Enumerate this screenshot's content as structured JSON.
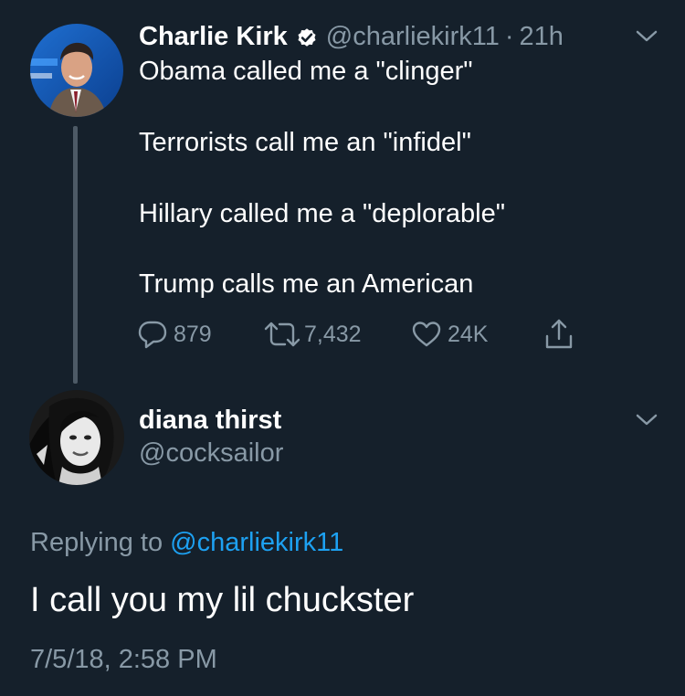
{
  "original_tweet": {
    "author_name": "Charlie Kirk",
    "verified": true,
    "handle": "@charliekirk11",
    "separator": "·",
    "time_ago": "21h",
    "lines": [
      "Obama called me a \"clinger\"",
      "Terrorists call me an \"infidel\"",
      "Hillary called me a \"deplorable\"",
      "Trump calls me an American"
    ],
    "actions": {
      "replies": "879",
      "retweets": "7,432",
      "likes": "24K"
    }
  },
  "reply_tweet": {
    "author_name": "diana thirst",
    "handle": "@cocksailor",
    "replying_prefix": "Replying to",
    "replying_mention": "@charliekirk11",
    "text": "I call you my lil chuckster",
    "timestamp": "7/5/18, 2:58 PM"
  },
  "colors": {
    "background": "#15202b",
    "text_primary": "#ffffff",
    "text_secondary": "#8899a6",
    "link": "#1da1f2",
    "thread_line": "#4d5a66"
  },
  "icons": {
    "verified": "verified-badge-icon",
    "reply": "reply-bubble-icon",
    "retweet": "retweet-icon",
    "like": "heart-icon",
    "share": "share-icon",
    "more": "chevron-down-icon"
  }
}
